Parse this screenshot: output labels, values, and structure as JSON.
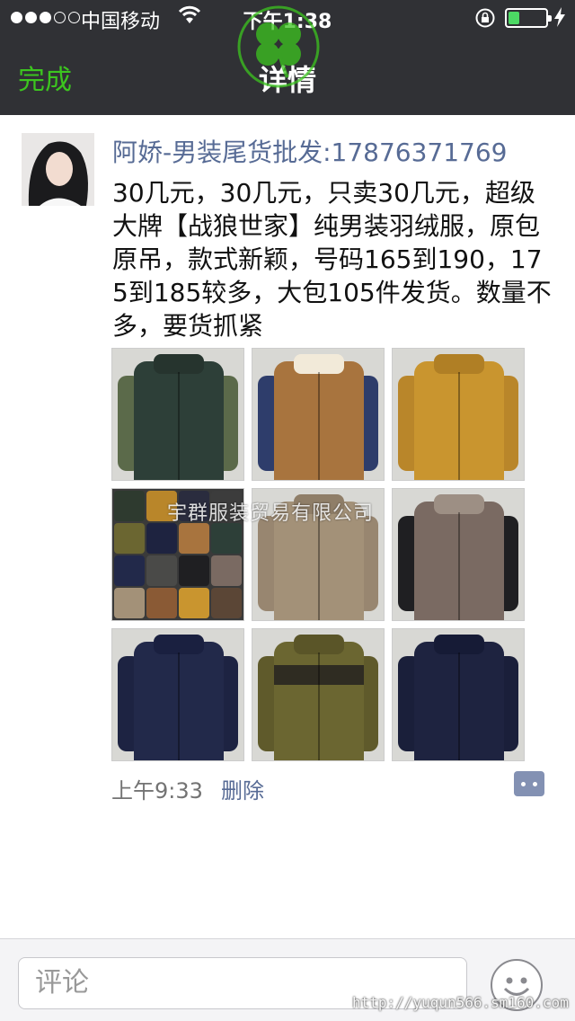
{
  "status_bar": {
    "carrier": "中国移动",
    "time": "下午1:38",
    "signal_bars_filled": 3,
    "signal_bars_total": 5,
    "battery_level": 0.3,
    "battery_color": "#4cd964"
  },
  "nav": {
    "done_label": "完成",
    "title": "详情"
  },
  "post": {
    "author": "阿娇-男装尾货批发:17876371769",
    "text": "30几元，30几元，只卖30几元，超级大牌【战狼世家】纯男装羽绒服，原包原吊，款式新颖，号码165到190，175到185较多，大包105件发货。数量不多，要货抓紧",
    "time": "上午9:33",
    "delete_label": "删除",
    "image_watermark": "宇群服装贸易有限公司",
    "images": [
      {
        "desc": "green jacket with dark green body and olive sleeves",
        "body": "#2d3f38",
        "sleeve": "#5b6a4a"
      },
      {
        "desc": "tan jacket with navy shoulders and sherpa collar",
        "body": "#a8743e",
        "sleeve": "#2e3d6b"
      },
      {
        "desc": "mustard yellow hooded jacket",
        "body": "#c9952f",
        "sleeve": "#c9952f"
      },
      {
        "desc": "collage of assorted jackets",
        "body": "#444444",
        "sleeve": "#444444"
      },
      {
        "desc": "khaki beige padded jacket",
        "body": "#a39178",
        "sleeve": "#a39178"
      },
      {
        "desc": "black and grey jacket with fur hood",
        "body": "#7a6a62",
        "sleeve": "#1f1f22"
      },
      {
        "desc": "navy hooded padded jacket",
        "body": "#22294a",
        "sleeve": "#22294a"
      },
      {
        "desc": "olive jacket with dark chest stripe",
        "body": "#6b6631",
        "sleeve": "#6b6631"
      },
      {
        "desc": "dark navy hooded jacket",
        "body": "#1e2340",
        "sleeve": "#1e2340"
      }
    ]
  },
  "comment_bar": {
    "placeholder": "评论",
    "emoji_icon": "smiley-icon"
  },
  "footer_watermark": "http://yuqun566.sm160.com",
  "colors": {
    "nav_bg": "#303135",
    "accent_green": "#3cc51f",
    "link_blue": "#576b95"
  }
}
